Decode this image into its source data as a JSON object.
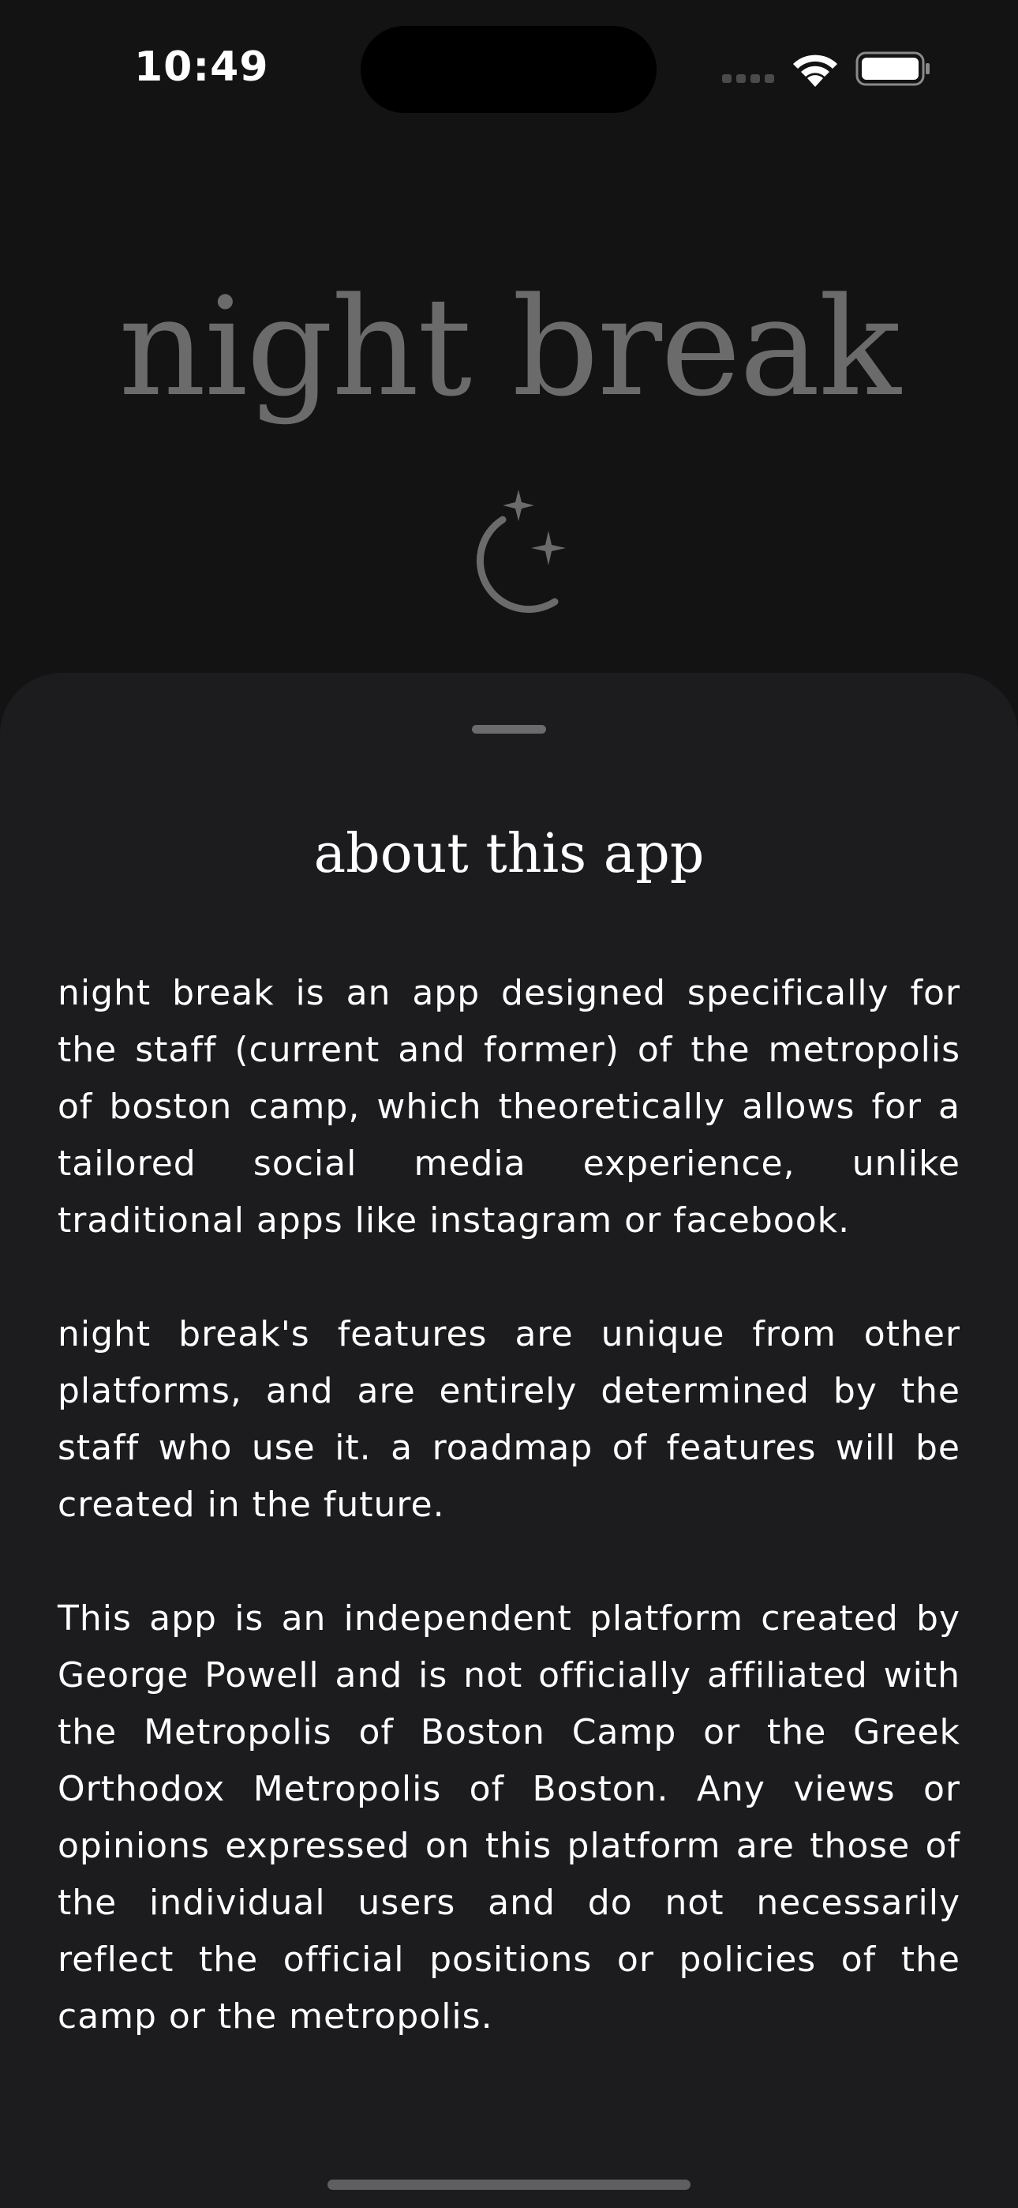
{
  "status_bar": {
    "time": "10:49",
    "signal_icon": "cellular-signal-icon",
    "wifi_icon": "wifi-icon",
    "battery_icon": "battery-icon"
  },
  "header": {
    "app_title": "night break",
    "logo_icon": "moon-stars-icon"
  },
  "sheet": {
    "title": "about this app",
    "paragraphs": [
      "night break is an app designed specifically for the staff (current and former) of the metropolis of boston camp, which theoretically allows for a tailored social media experience, unlike traditional apps like instagram or facebook.",
      "night break's features are unique from other platforms, and are entirely determined by the staff who use it. a roadmap of features will be created in the future.",
      "This app is an independent platform created by George Powell and is not officially affiliated with the Metropolis of Boston Camp or the Greek Orthodox Metropolis of Boston. Any views or opinions expressed on this platform are those of the individual users and do not necessarily reflect the official positions or policies of the camp or the metropolis."
    ]
  },
  "colors": {
    "background": "#131313",
    "sheet": "#1c1c1e",
    "title_muted": "#6b6b6b",
    "text": "#ffffff"
  }
}
